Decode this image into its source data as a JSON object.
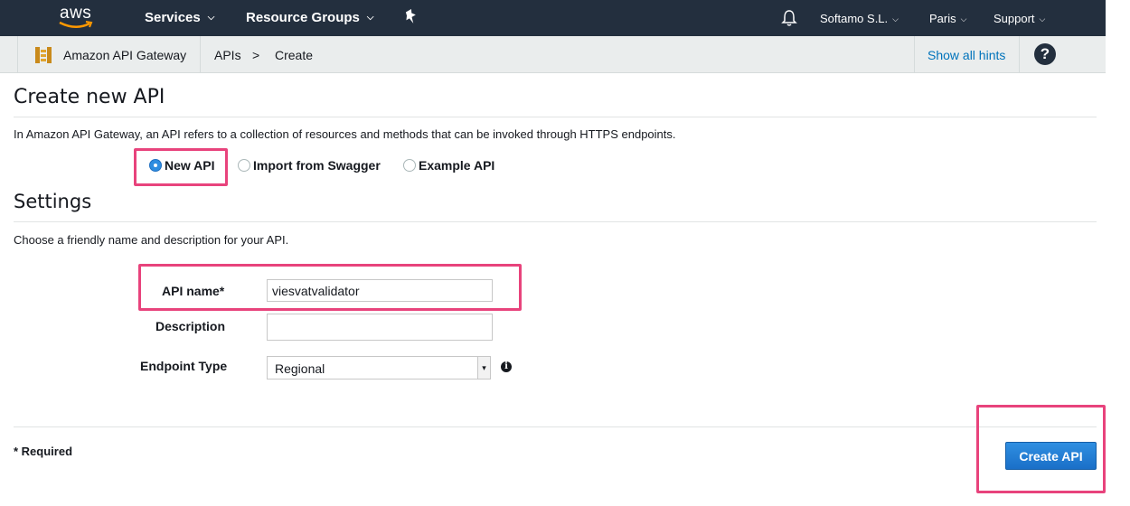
{
  "colors": {
    "nav_bg": "#232f3e",
    "subnav_bg": "#eaeded",
    "link": "#0073bb",
    "primary_button": "#2079d0",
    "highlight": "#e8437c"
  },
  "topnav": {
    "logo_text": "aws",
    "services": "Services",
    "resource_groups": "Resource Groups",
    "account": "Softamo S.L.",
    "region": "Paris",
    "support": "Support"
  },
  "subnav": {
    "service_name": "Amazon API Gateway",
    "breadcrumb": [
      "APIs",
      ">",
      "Create"
    ],
    "hints_link": "Show all hints",
    "help": "?"
  },
  "page": {
    "title": "Create new API",
    "description": "In Amazon API Gateway, an API refers to a collection of resources and methods that can be invoked through HTTPS endpoints.",
    "api_type_options": [
      {
        "label": "New API",
        "selected": true
      },
      {
        "label": "Import from Swagger",
        "selected": false
      },
      {
        "label": "Example API",
        "selected": false
      }
    ]
  },
  "settings": {
    "title": "Settings",
    "description": "Choose a friendly name and description for your API.",
    "api_name_label": "API name*",
    "api_name_value": "viesvatvalidator",
    "description_label": "Description",
    "description_value": "",
    "endpoint_type_label": "Endpoint Type",
    "endpoint_type_value": "Regional",
    "info": "i"
  },
  "footer": {
    "required_note": "* Required",
    "create_button": "Create API"
  }
}
